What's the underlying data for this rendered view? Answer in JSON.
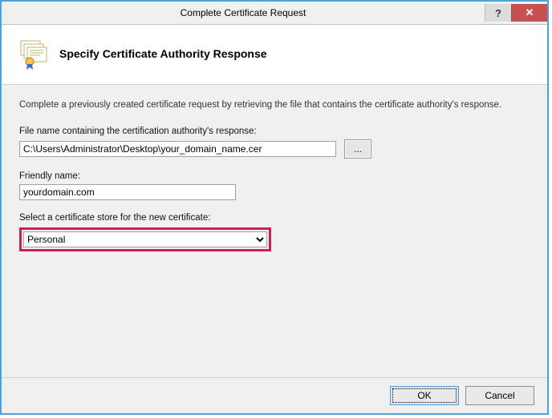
{
  "window": {
    "title": "Complete Certificate Request",
    "help_symbol": "?",
    "close_symbol": "✕"
  },
  "header": {
    "heading": "Specify Certificate Authority Response"
  },
  "body": {
    "description": "Complete a previously created certificate request by retrieving the file that contains the certificate authority's response.",
    "file_label": "File name containing the certification authority's response:",
    "file_value": "C:\\Users\\Administrator\\Desktop\\your_domain_name.cer",
    "browse_label": "...",
    "friendly_label": "Friendly name:",
    "friendly_value": "yourdomain.com",
    "store_label": "Select a certificate store for the new certificate:",
    "store_value": "Personal"
  },
  "buttons": {
    "ok": "OK",
    "cancel": "Cancel"
  }
}
